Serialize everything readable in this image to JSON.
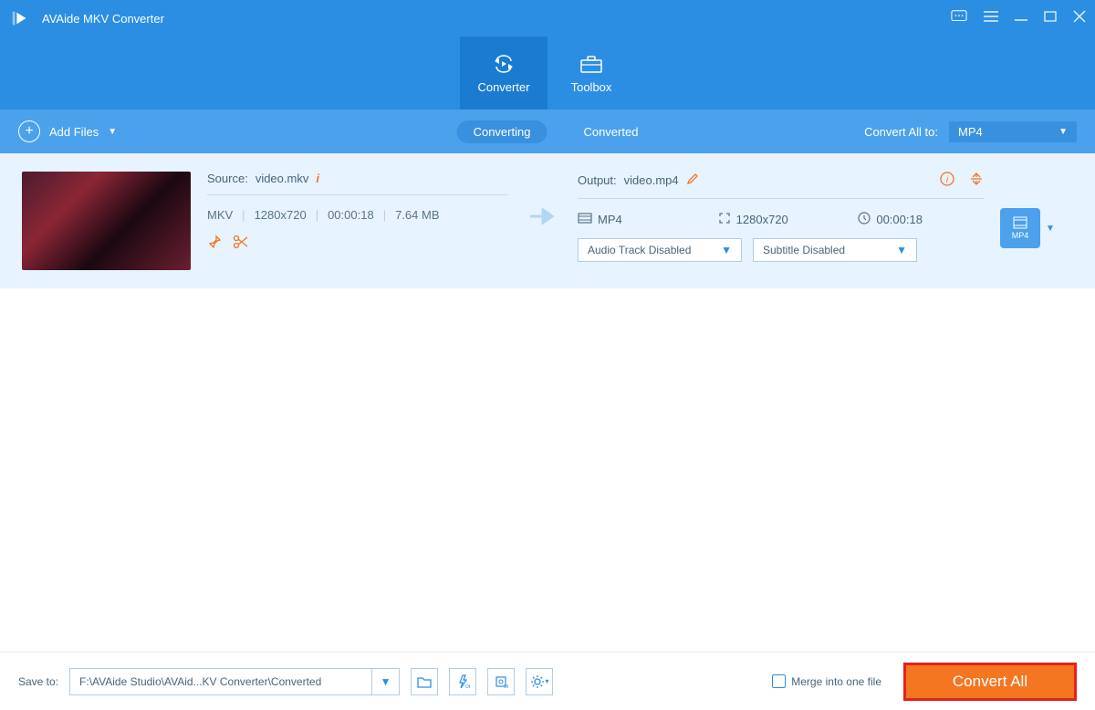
{
  "titlebar": {
    "app_title": "AVAide MKV Converter"
  },
  "main_tabs": {
    "converter": "Converter",
    "toolbox": "Toolbox"
  },
  "subbar": {
    "add_files": "Add Files",
    "converting": "Converting",
    "converted": "Converted",
    "convert_all_to": "Convert All to:",
    "format": "MP4"
  },
  "file": {
    "source_label": "Source:",
    "source_name": "video.mkv",
    "src_fmt": "MKV",
    "src_res": "1280x720",
    "src_dur": "00:00:18",
    "src_size": "7.64 MB",
    "output_label": "Output:",
    "output_name": "video.mp4",
    "out_fmt": "MP4",
    "out_res": "1280x720",
    "out_dur": "00:00:18",
    "audio_dd": "Audio Track Disabled",
    "subtitle_dd": "Subtitle Disabled",
    "badge": "MP4"
  },
  "bottom": {
    "save_to": "Save to:",
    "path": "F:\\AVAide Studio\\AVAid...KV Converter\\Converted",
    "merge": "Merge into one file",
    "convert": "Convert All"
  }
}
